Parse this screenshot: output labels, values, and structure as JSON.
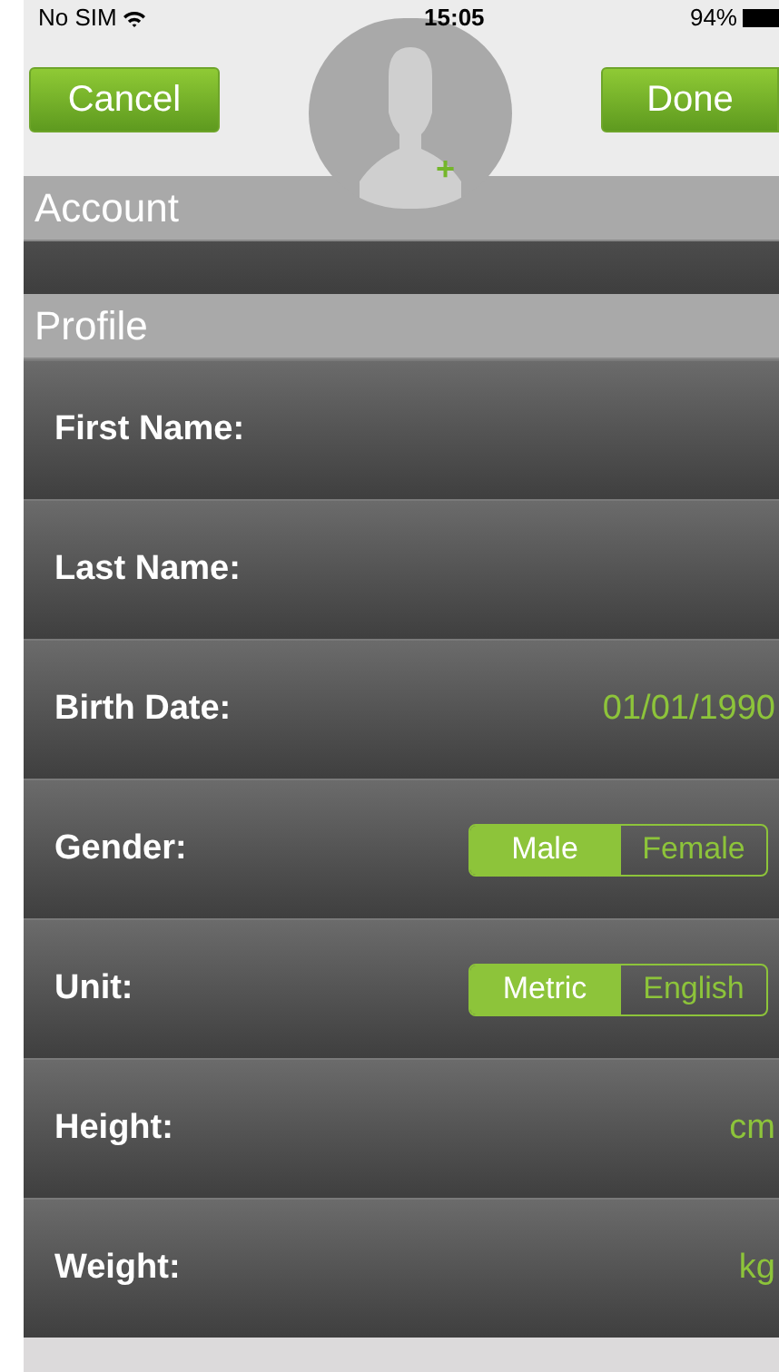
{
  "status_bar": {
    "carrier": "No SIM",
    "time": "15:05",
    "battery": "94%"
  },
  "nav": {
    "left_button": "Cancel",
    "right_button": "Done",
    "avatar_add": "+"
  },
  "sections": [
    {
      "title": "Account",
      "rows": [
        {
          "kind": "blank"
        }
      ]
    },
    {
      "title": "Profile",
      "rows": [
        {
          "kind": "field",
          "label": "First Name:"
        },
        {
          "kind": "field",
          "label": "Last Name:"
        },
        {
          "kind": "field",
          "label": "Birth Date:",
          "value": "01/01/1990"
        },
        {
          "kind": "segmented",
          "label": "Gender:",
          "options": [
            {
              "label": "Male",
              "selected": true
            },
            {
              "label": "Female",
              "selected": false
            }
          ]
        },
        {
          "kind": "segmented",
          "label": "Unit:",
          "options": [
            {
              "label": "Metric",
              "selected": true
            },
            {
              "label": "English",
              "selected": false
            }
          ]
        },
        {
          "kind": "field",
          "label": "Height:",
          "value": "cm"
        },
        {
          "kind": "field",
          "label": "Weight:",
          "value": "kg"
        }
      ]
    }
  ]
}
